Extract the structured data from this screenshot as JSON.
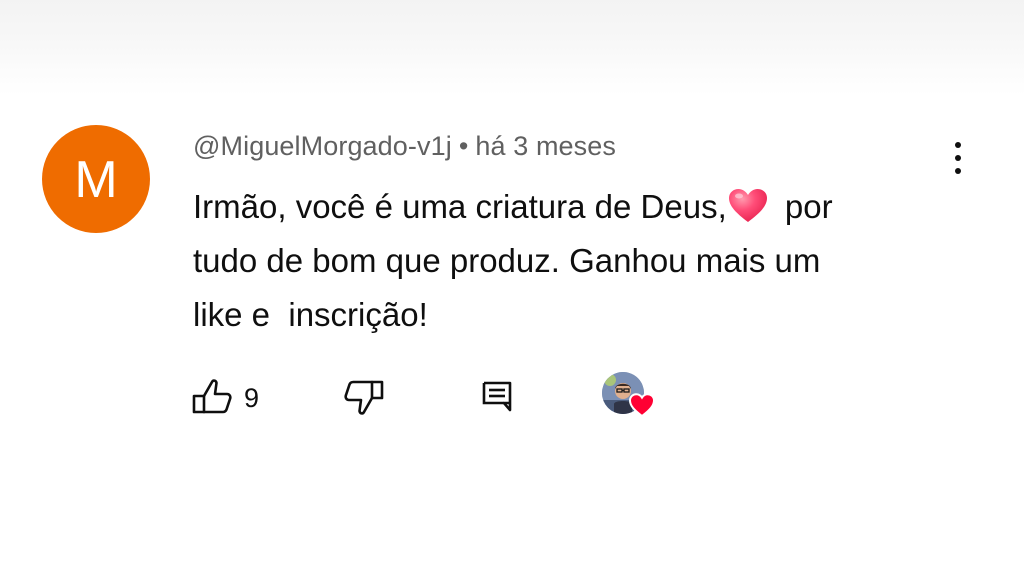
{
  "comment": {
    "author": "@MiguelMorgado-v1j",
    "separator": "•",
    "time": "há 3 meses",
    "avatar_letter": "M",
    "avatar_color": "#ef6c00",
    "lines": [
      "Irmão, você é uma criatura de Deus,",
      " por",
      "tudo de bom que produz. Ganhou mais um",
      "like e  inscrição!"
    ],
    "emoji": "heart-emoji"
  },
  "actions": {
    "like_count": "9",
    "like_icon": "thumbs-up-icon",
    "dislike_icon": "thumbs-down-icon",
    "reply_icon": "reply-comment-icon",
    "creator_heart": "creator-heart-icon"
  },
  "colors": {
    "text": "#0f0f0f",
    "meta": "#606060",
    "heart": "#ff0033"
  }
}
